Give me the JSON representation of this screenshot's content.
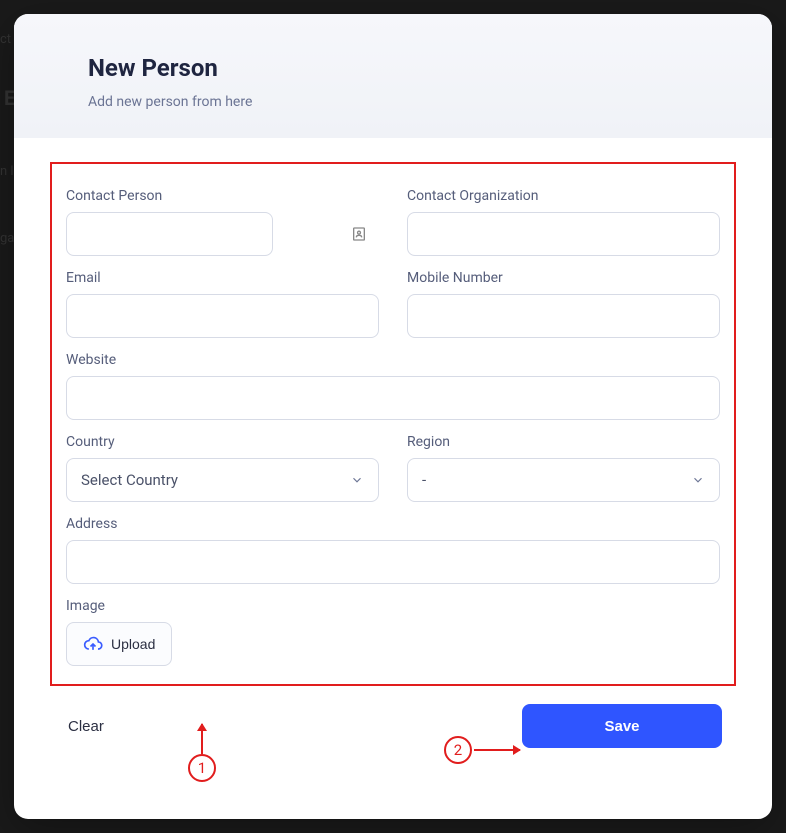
{
  "backdrop": {
    "t1": "ct",
    "t2": "E",
    "t3": "n l",
    "t4": "ga"
  },
  "header": {
    "title": "New Person",
    "subtitle": "Add new person from here"
  },
  "form": {
    "contact_person_label": "Contact Person",
    "contact_person_value": "",
    "contact_org_label": "Contact Organization",
    "contact_org_value": "",
    "email_label": "Email",
    "email_value": "",
    "mobile_label": "Mobile Number",
    "mobile_value": "",
    "website_label": "Website",
    "website_value": "",
    "country_label": "Country",
    "country_selected": "Select Country",
    "region_label": "Region",
    "region_selected": "-",
    "address_label": "Address",
    "address_value": "",
    "image_label": "Image",
    "upload_label": "Upload"
  },
  "footer": {
    "clear_label": "Clear",
    "save_label": "Save"
  },
  "annotations": {
    "a1": "1",
    "a2": "2"
  }
}
